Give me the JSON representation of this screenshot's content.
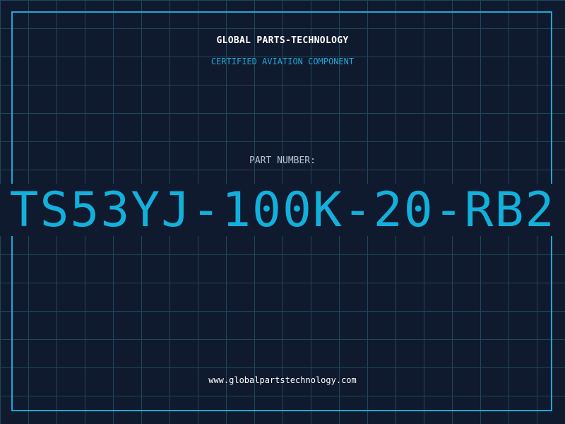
{
  "header": {
    "company": "GLOBAL PARTS-TECHNOLOGY",
    "tagline": "CERTIFIED AVIATION COMPONENT"
  },
  "part": {
    "label": "PART NUMBER:",
    "number": "TS53YJ-100K-20-RB2"
  },
  "footer": {
    "website": "www.globalpartstechnology.com"
  },
  "colors": {
    "background": "#101a2e",
    "grid": "#1f4660",
    "accent": "#14b0dc",
    "frame": "#1ea8d6"
  }
}
